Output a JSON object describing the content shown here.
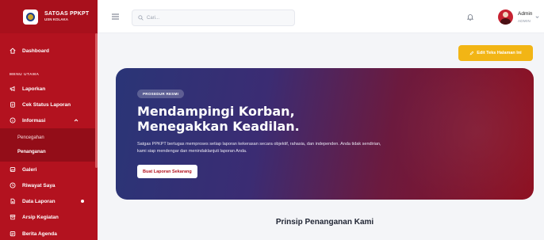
{
  "brand": {
    "title": "SATGAS PPKPT",
    "subtitle": "USN KOLAKA"
  },
  "sidebar": {
    "dashboard": "Dashboard",
    "section_label": "MENU UTAMA",
    "items": {
      "laporkan": "Laporkan",
      "cek_status": "Cek Status Laporan",
      "informasi": "Informasi",
      "pencegahan": "Pencegahan",
      "penanganan": "Penanganan",
      "galeri": "Galeri",
      "riwayat": "Riwayat Saya",
      "data_laporan": "Data Laporan",
      "arsip": "Arsip Kegiatan",
      "berita": "Berita Agenda"
    }
  },
  "topbar": {
    "search_placeholder": "Cari...",
    "user_name": "Admin",
    "user_role": "ADMIN"
  },
  "toolbar": {
    "edit_label": "Edit Teks Halaman Ini"
  },
  "hero": {
    "badge": "PROSEDUR RESMI",
    "headline_line1": "Mendampingi Korban,",
    "headline_line2": "Menegakkan Keadilan.",
    "lead": "Satgas PPKPT bertugas memproses setiap laporan kekerasan secara objektif, rahasia, dan independen. Anda tidak sendirian, kami siap mendengar dan menindaklanjuti laporan Anda.",
    "cta": "Buat Laporan Sekarang"
  },
  "section": {
    "title": "Prinsip Penanganan Kami"
  },
  "colors": {
    "sidebar": "#b3121f",
    "accent": "#f2b515",
    "hero_start": "#2a3577",
    "hero_end": "#8e1021"
  },
  "icons": [
    "home-icon",
    "megaphone-icon",
    "clipboard-icon",
    "info-icon",
    "image-icon",
    "history-icon",
    "file-icon",
    "archive-icon",
    "news-icon",
    "menu-icon",
    "search-icon",
    "bell-icon",
    "chevron-down-icon",
    "edit-icon"
  ]
}
